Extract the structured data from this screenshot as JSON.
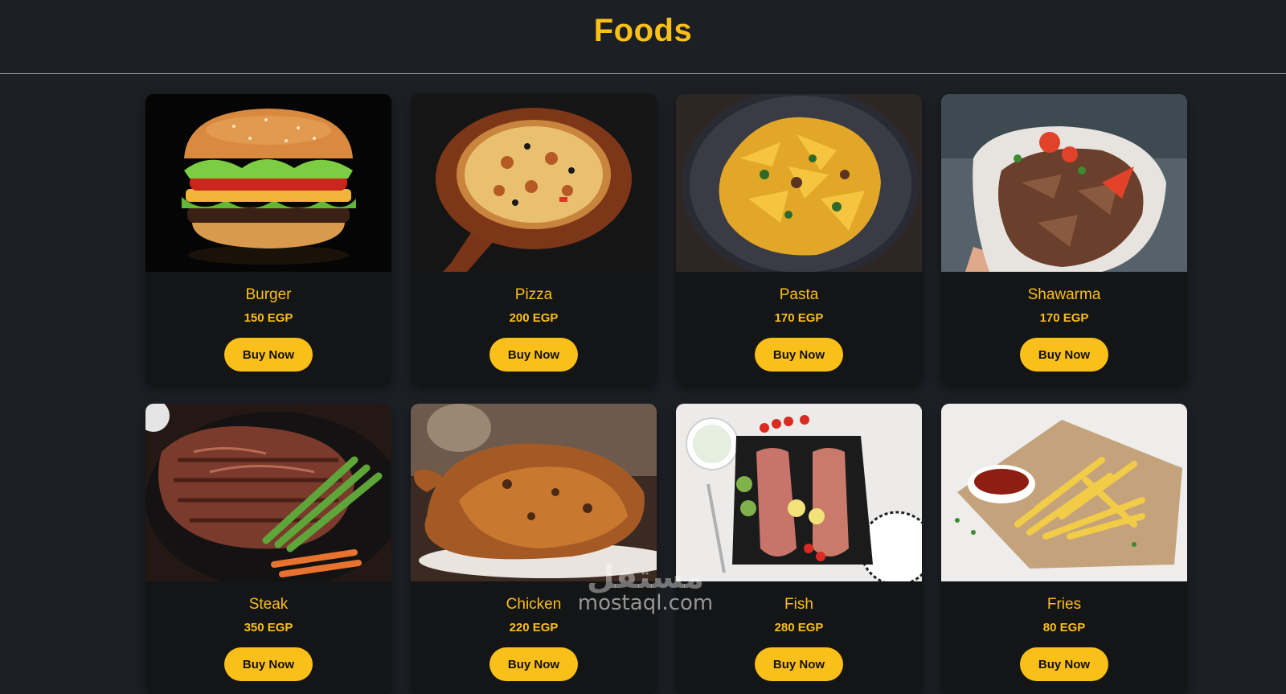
{
  "page": {
    "title": "Foods"
  },
  "colors": {
    "accent": "#fbbf19",
    "background": "#1c1f24",
    "card": "#141516"
  },
  "items": [
    {
      "name": "Burger",
      "price": "150 EGP",
      "button": "Buy Now"
    },
    {
      "name": "Pizza",
      "price": "200 EGP",
      "button": "Buy Now"
    },
    {
      "name": "Pasta",
      "price": "170 EGP",
      "button": "Buy Now"
    },
    {
      "name": "Shawarma",
      "price": "170 EGP",
      "button": "Buy Now"
    },
    {
      "name": "Steak",
      "price": "350 EGP",
      "button": "Buy Now"
    },
    {
      "name": "Chicken",
      "price": "220 EGP",
      "button": "Buy Now"
    },
    {
      "name": "Fish",
      "price": "280 EGP",
      "button": "Buy Now"
    },
    {
      "name": "Fries",
      "price": "80 EGP",
      "button": "Buy Now"
    }
  ],
  "watermark": {
    "arabic": "مستقل",
    "text": "mostaql.com"
  }
}
